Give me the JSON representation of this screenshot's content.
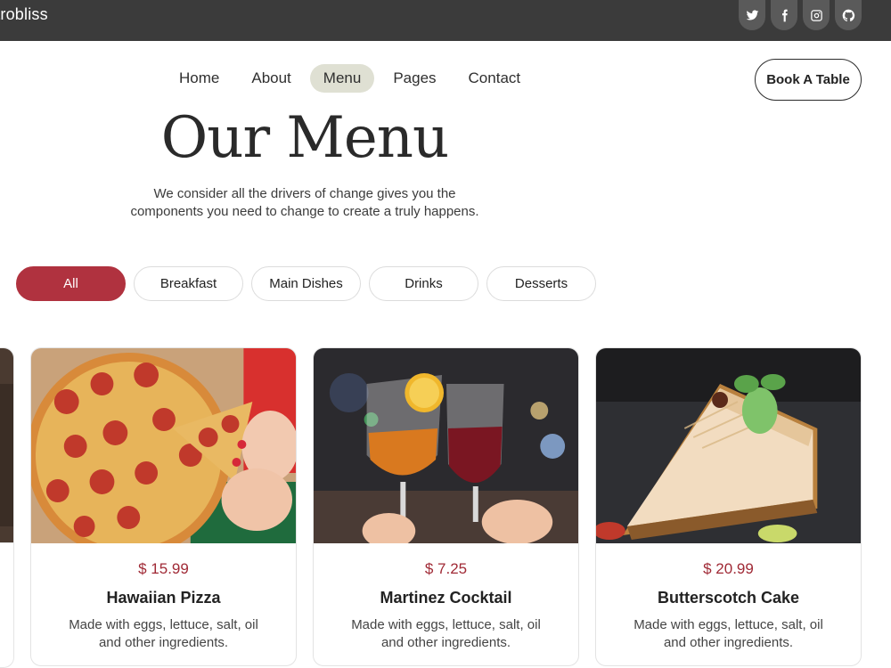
{
  "header": {
    "brand": "strobliss",
    "socials": [
      {
        "icon": "twitter-icon"
      },
      {
        "icon": "facebook-icon"
      },
      {
        "icon": "instagram-icon"
      },
      {
        "icon": "github-icon"
      }
    ]
  },
  "nav": {
    "items": [
      "Home",
      "About",
      "Menu",
      "Pages",
      "Contact"
    ],
    "active": "Menu",
    "book_label": "Book A Table"
  },
  "hero": {
    "title": "Our Menu",
    "subtitle_line1": "We consider all the drivers of change gives you the",
    "subtitle_line2": "components you need to change to create a truly happens."
  },
  "filters": {
    "items": [
      "All",
      "Breakfast",
      "Main Dishes",
      "Drinks",
      "Desserts"
    ],
    "active": "All"
  },
  "cards": [
    {
      "price": "$ 15.99",
      "name": "Hawaiian Pizza",
      "desc_line1": "Made with eggs, lettuce, salt, oil",
      "desc_line2": "and other ingredients.",
      "image": "pizza-image"
    },
    {
      "price": "$ 7.25",
      "name": "Martinez Cocktail",
      "desc_line1": "Made with eggs, lettuce, salt, oil",
      "desc_line2": "and other ingredients.",
      "image": "cocktail-image"
    },
    {
      "price": "$ 20.99",
      "name": "Butterscotch Cake",
      "desc_line1": "Made with eggs, lettuce, salt, oil",
      "desc_line2": "and other ingredients.",
      "image": "cake-image"
    }
  ],
  "colors": {
    "accent": "#b0323f",
    "price": "#a02a36",
    "topbar": "#3b3b3b",
    "nav_active": "#dfe0d3"
  }
}
